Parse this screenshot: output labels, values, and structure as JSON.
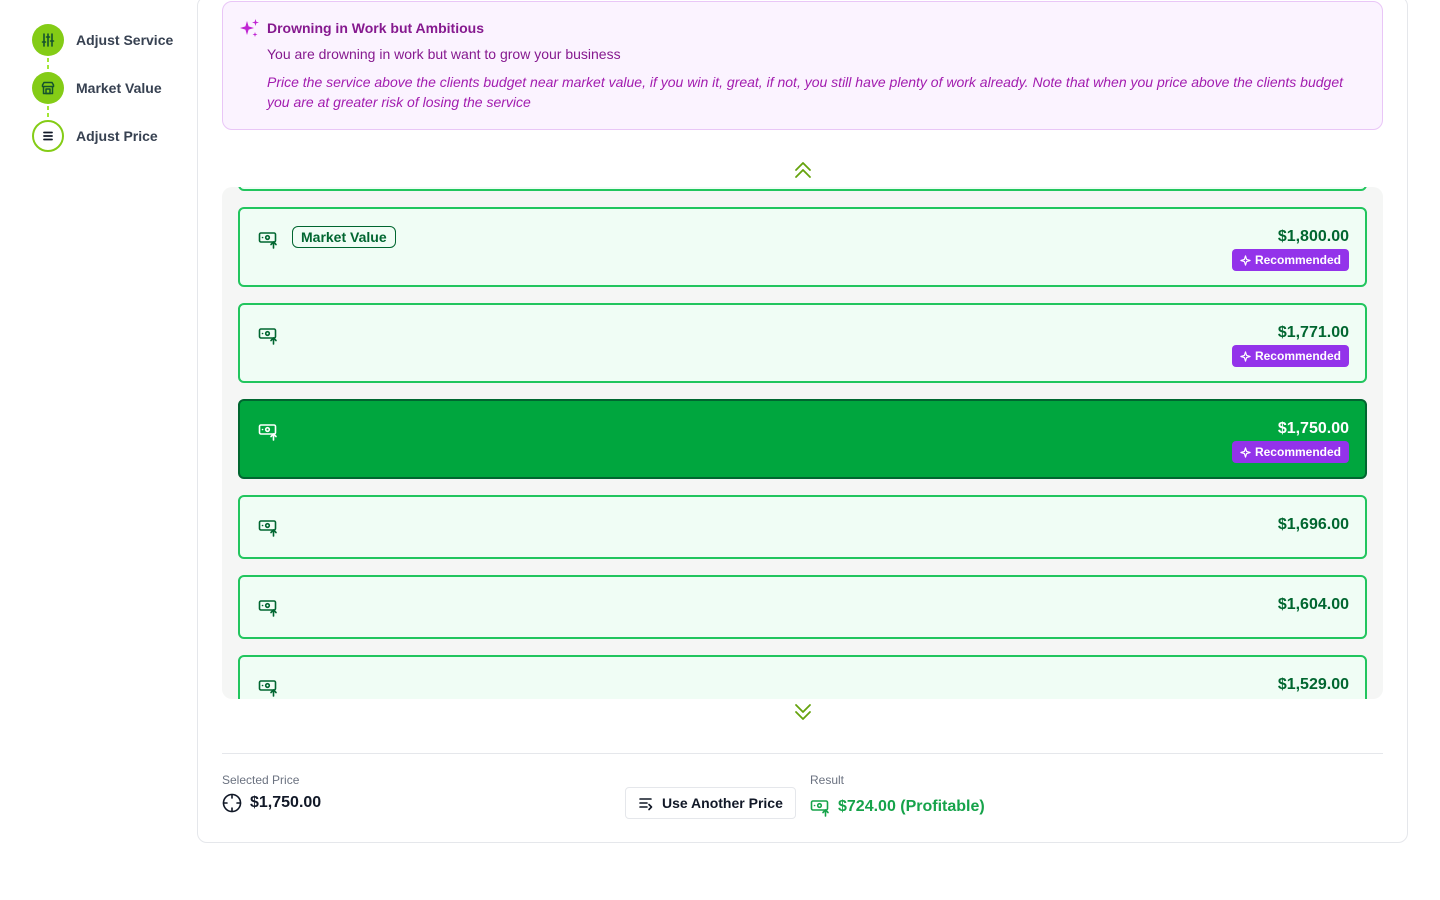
{
  "stepper": {
    "steps": [
      {
        "label": "Adjust Service",
        "state": "done",
        "icon": "sliders-icon"
      },
      {
        "label": "Market Value",
        "state": "done",
        "icon": "store-icon"
      },
      {
        "label": "Adjust Price",
        "state": "current",
        "icon": "list-icon"
      }
    ]
  },
  "insight": {
    "title": "Drowning in Work but Ambitious",
    "subtitle": "You are drowning in work but want to grow your business",
    "body": "Price the service above the clients budget near market value, if you win it, great, if not, you still have plenty of work already. Note that when you price above the clients budget you are at greater risk of losing the service",
    "icon": "sparkles-icon"
  },
  "price_list": {
    "market_value_tag": "Market Value",
    "recommended_label": "Recommended",
    "rows": [
      {
        "price": "$1,800.00",
        "market_value": true,
        "recommended": true,
        "selected": false
      },
      {
        "price": "$1,771.00",
        "market_value": false,
        "recommended": true,
        "selected": false
      },
      {
        "price": "$1,750.00",
        "market_value": false,
        "recommended": true,
        "selected": true
      },
      {
        "price": "$1,696.00",
        "market_value": false,
        "recommended": false,
        "selected": false
      },
      {
        "price": "$1,604.00",
        "market_value": false,
        "recommended": false,
        "selected": false
      },
      {
        "price": "$1,529.00",
        "market_value": false,
        "recommended": false,
        "selected": false
      }
    ]
  },
  "footer": {
    "selected_label": "Selected Price",
    "selected_value": "$1,750.00",
    "use_another_label": "Use Another Price",
    "result_label": "Result",
    "result_value": "$724.00 (Profitable)"
  },
  "colors": {
    "accent_lime": "#84cc16",
    "row_border": "#22c55e",
    "row_bg": "#f0fdf5",
    "selected_bg": "#00a63e",
    "price_text": "#016630",
    "recommended_bg": "#9333ea",
    "insight_text": "#86198f"
  }
}
